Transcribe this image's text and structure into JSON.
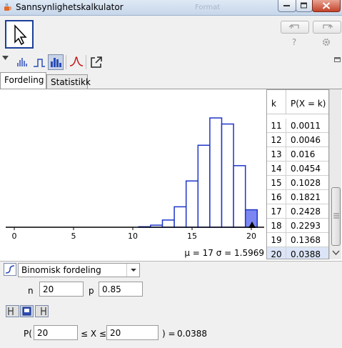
{
  "window": {
    "title": "Sannsynlighetskalkulator",
    "ghost_label": "Format"
  },
  "icons": {
    "app": "java-cup-icon",
    "mode": "arrow-pointer-icon",
    "undo": "undo-arrow-icon",
    "redo": "redo-arrow-icon",
    "help": "help-icon",
    "settings": "gear-icon",
    "collapse": "triangle-down-icon",
    "export": "export-arrow-icon"
  },
  "toolbar": {
    "help_label": "?"
  },
  "tabs": [
    {
      "label": "Fordeling"
    },
    {
      "label": "Statistikk"
    }
  ],
  "colors": {
    "bar_stroke": "#1f35c9",
    "bar_selected_fill": "#7b86f0",
    "selection_row": "#dce5f7"
  },
  "chart_data": {
    "type": "bar",
    "x": [
      11,
      12,
      13,
      14,
      15,
      16,
      17,
      18,
      19,
      20
    ],
    "values": [
      0.0011,
      0.0046,
      0.016,
      0.0454,
      0.1028,
      0.1821,
      0.2428,
      0.2293,
      0.1368,
      0.0388
    ],
    "highlighted_x": [
      20
    ],
    "xticks": [
      0,
      5,
      10,
      15,
      20
    ],
    "xlim": [
      -1,
      21
    ],
    "title": "",
    "xlabel": "",
    "ylabel": "",
    "grid": false,
    "summary": "μ = 17   σ = 1.5969"
  },
  "table": {
    "headers": [
      "k",
      "P(X = k)"
    ],
    "rows": [
      {
        "k": "11",
        "p": "0.0011"
      },
      {
        "k": "12",
        "p": "0.0046"
      },
      {
        "k": "13",
        "p": "0.016"
      },
      {
        "k": "14",
        "p": "0.0454"
      },
      {
        "k": "15",
        "p": "0.1028"
      },
      {
        "k": "16",
        "p": "0.1821"
      },
      {
        "k": "17",
        "p": "0.2428"
      },
      {
        "k": "18",
        "p": "0.2293"
      },
      {
        "k": "19",
        "p": "0.1368"
      },
      {
        "k": "20",
        "p": "0.0388"
      }
    ],
    "selected_k": "20"
  },
  "controls": {
    "distribution": "Binomisk fordeling",
    "n_label": "n",
    "n_value": "20",
    "p_label": "p",
    "p_value": "0.85",
    "prob_prefix": "P(",
    "lower_value": "20",
    "between_symbol": "≤ X ≤",
    "upper_value": "20",
    "result_label": ") =",
    "result_value": "0.0388"
  }
}
